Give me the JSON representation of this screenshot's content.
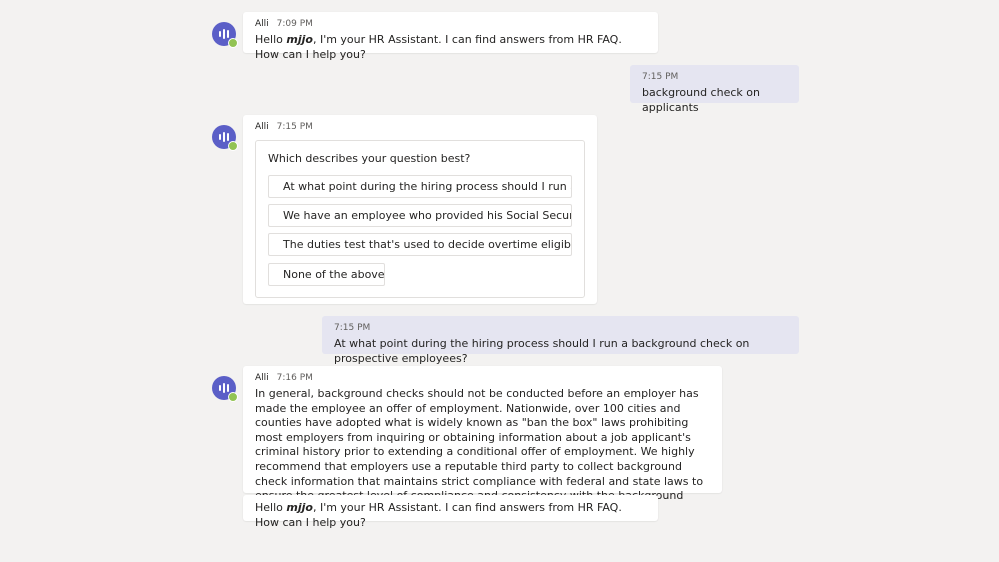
{
  "bot": {
    "name": "Alli"
  },
  "messages": [
    {
      "time": "7:09 PM",
      "greet_pre": "Hello ",
      "user": "mjjo",
      "greet_post": ", I'm your HR Assistant. I can find answers from HR FAQ. How can I help you?"
    },
    {
      "time": "7:15 PM",
      "text": "background check on applicants"
    },
    {
      "time": "7:15 PM",
      "question": "Which describes your question best?",
      "options": [
        "At what point during the hiring process should I run a background check on prospective employees?",
        "We have an employee who provided his Social Security card and it was not valid.",
        "The duties test that's used to decide overtime eligibility to employees.",
        "None of the above"
      ]
    },
    {
      "time": "7:15 PM",
      "text": "At what point during the hiring process should I run a background check on prospective employees?"
    },
    {
      "time": "7:16 PM",
      "text": "In general, background checks should not be conducted before an employer has made the employee an offer of employment. Nationwide, over 100 cities and counties have adopted what is widely known as \"ban the box\" laws prohibiting most employers from inquiring or obtaining information about a job applicant's criminal history prior to extending a conditional offer of employment. We highly recommend that employers use a reputable third party to collect background check information that maintains strict compliance with federal and state laws to ensure the greatest level of compliance and consistency with the background check process."
    },
    {
      "greet_pre": "Hello ",
      "user": "mjjo",
      "greet_post": ", I'm your HR Assistant. I can find answers from HR FAQ. How can I help you?"
    }
  ]
}
